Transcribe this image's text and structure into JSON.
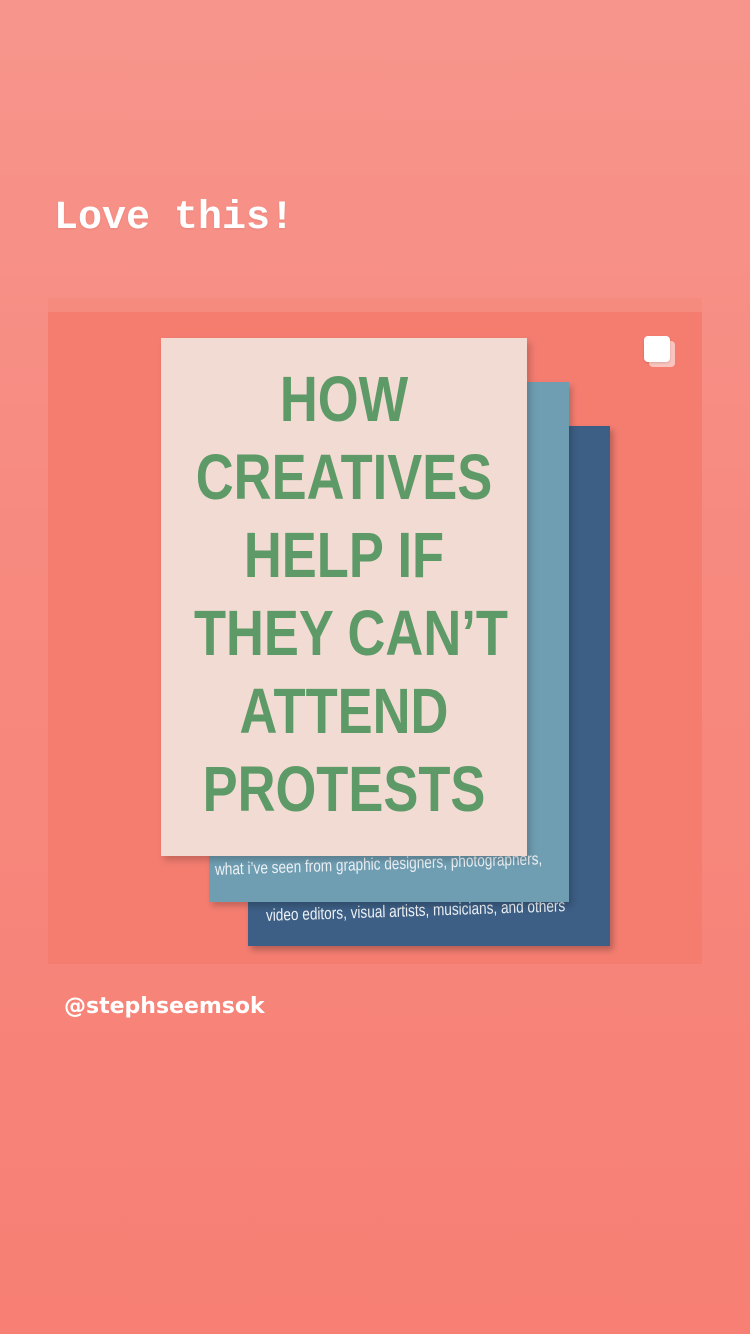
{
  "story": {
    "caption": "Love this!",
    "username": "@stephseemsok"
  },
  "post": {
    "multi_icon": "carousel-icon",
    "poster": {
      "title_lines": [
        "HOW",
        "CREATIVES",
        "HELP IF",
        "THEY CAN’T",
        "ATTEND",
        "PROTESTS"
      ],
      "subtitle_line_1": "what i’ve seen from graphic designers, photographers,",
      "subtitle_line_2": "video editors, visual artists, musicians, and others"
    }
  },
  "colors": {
    "background": "#f78a80",
    "card": "#f47d70",
    "cream_sheet": "#f1dbd2",
    "blue_sheet": "#6f9db2",
    "navy_sheet": "#3d5f85",
    "title_green": "#5d9a67"
  }
}
